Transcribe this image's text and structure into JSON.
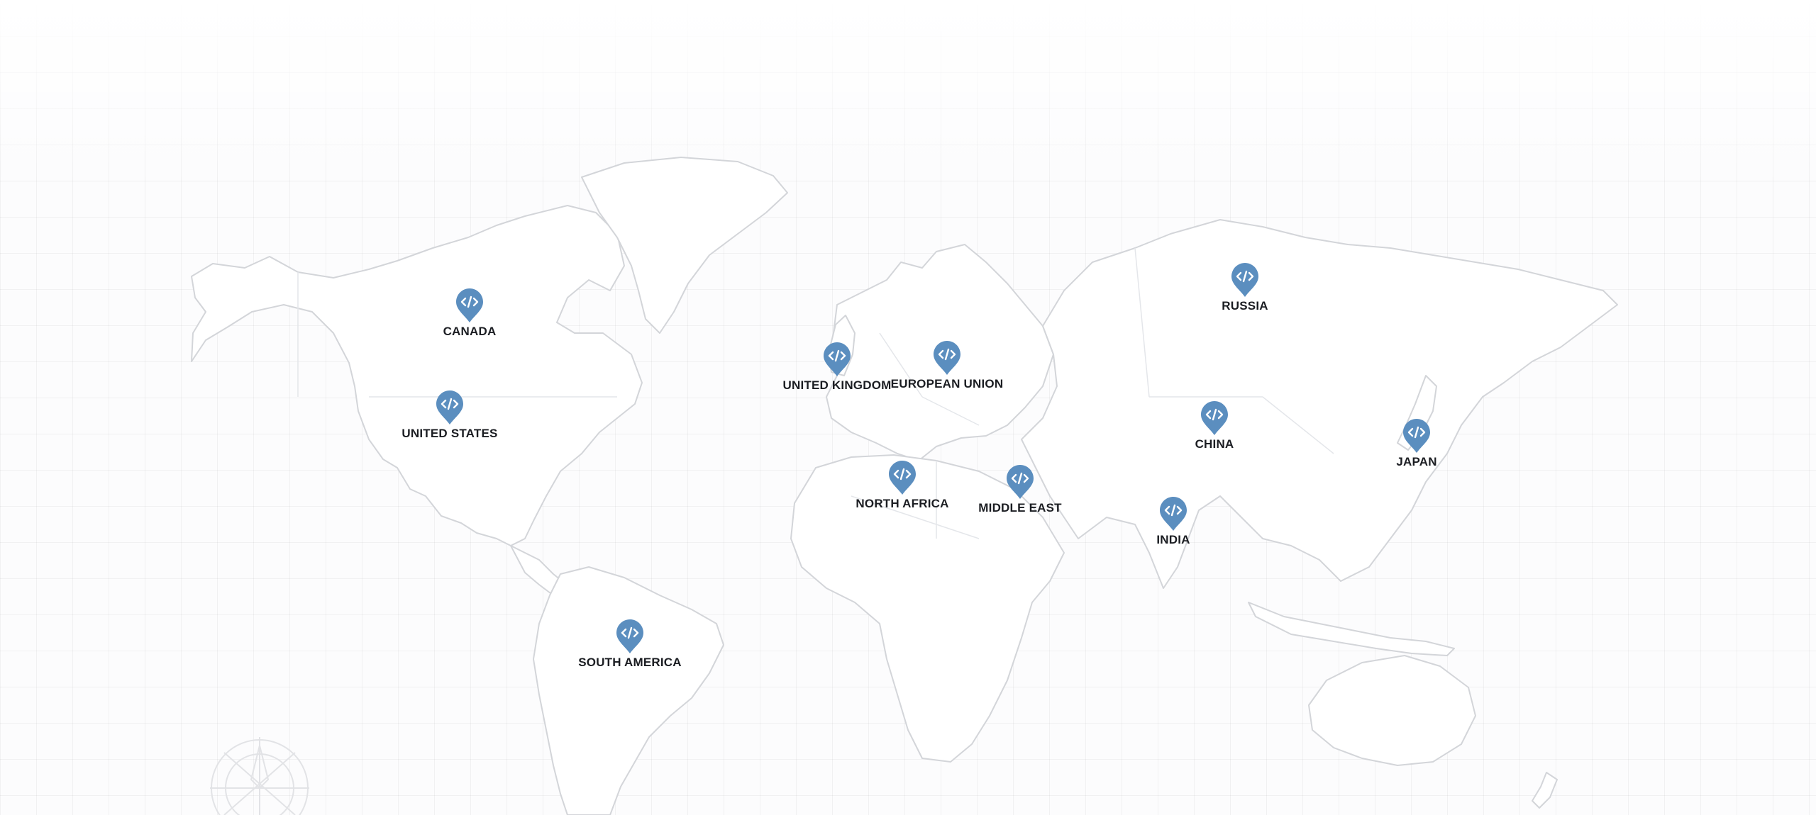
{
  "map": {
    "markers": [
      {
        "id": "canada",
        "label": "CANADA",
        "icon": "code-icon"
      },
      {
        "id": "united-states",
        "label": "UNITED STATES",
        "icon": "code-icon"
      },
      {
        "id": "south-america",
        "label": "SOUTH AMERICA",
        "icon": "code-icon"
      },
      {
        "id": "united-kingdom",
        "label": "UNITED KINGDOM",
        "icon": "code-icon"
      },
      {
        "id": "european-union",
        "label": "EUROPEAN UNION",
        "icon": "code-icon"
      },
      {
        "id": "north-africa",
        "label": "NORTH AFRICA",
        "icon": "code-icon"
      },
      {
        "id": "middle-east",
        "label": "MIDDLE EAST",
        "icon": "code-icon"
      },
      {
        "id": "russia",
        "label": "RUSSIA",
        "icon": "code-icon"
      },
      {
        "id": "china",
        "label": "CHINA",
        "icon": "code-icon"
      },
      {
        "id": "india",
        "label": "INDIA",
        "icon": "code-icon"
      },
      {
        "id": "japan",
        "label": "JAPAN",
        "icon": "code-icon"
      }
    ],
    "colors": {
      "pin": "#5b8ebf",
      "land_outline": "#d3d5d9",
      "label": "#1b1d22",
      "background": "#fcfcfd"
    }
  }
}
